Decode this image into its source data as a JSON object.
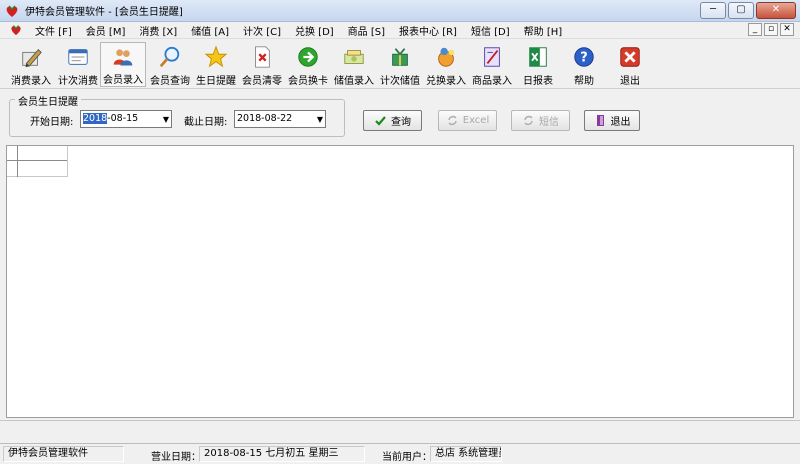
{
  "window": {
    "title": "伊特会员管理软件 - [会员生日提醒]",
    "controls": [
      "─",
      "▢",
      "✕"
    ]
  },
  "menu": {
    "items": [
      "文件 [F]",
      "会员 [M]",
      "消费 [X]",
      "储值 [A]",
      "计次 [C]",
      "兑换 [D]",
      "商品 [S]",
      "报表中心 [R]",
      "短信 [D]",
      "帮助 [H]"
    ],
    "mdi_controls": [
      "_",
      "▫",
      "✕"
    ]
  },
  "toolbar": {
    "buttons": [
      {
        "label": "消费录入",
        "icon": "pen-paper-icon"
      },
      {
        "label": "计次消费",
        "icon": "card-list-icon"
      },
      {
        "label": "会员录入",
        "icon": "members-icon"
      },
      {
        "label": "会员查询",
        "icon": "magnifier-icon"
      },
      {
        "label": "生日提醒",
        "icon": "star-icon"
      },
      {
        "label": "会员清零",
        "icon": "document-x-icon"
      },
      {
        "label": "会员换卡",
        "icon": "green-arrow-icon"
      },
      {
        "label": "储值录入",
        "icon": "money-icon"
      },
      {
        "label": "计次储值",
        "icon": "gift-icon"
      },
      {
        "label": "兑换录入",
        "icon": "exchange-icon"
      },
      {
        "label": "商品录入",
        "icon": "notebook-icon"
      },
      {
        "label": "日报表",
        "icon": "excel-icon"
      },
      {
        "label": "帮助",
        "icon": "help-icon"
      },
      {
        "label": "退出",
        "icon": "exit-x-icon"
      }
    ]
  },
  "filter": {
    "group_title": "会员生日提醒",
    "start_label": "开始日期:",
    "start_value_selected": "2018",
    "start_value_rest": "-08-15",
    "end_label": "截止日期:",
    "end_value": "2018-08-22"
  },
  "actions": {
    "query": "查询",
    "excel": "Excel",
    "sms": "短信",
    "exit": "退出"
  },
  "statusbar": {
    "app_name": "伊特会员管理软件",
    "business_date_label": "营业日期：",
    "business_date_value": "2018-08-15  七月初五  星期三",
    "current_user_label": "当前用户：",
    "current_user_value": "总店 系统管理员"
  },
  "colors": {
    "titlebar": "#c5d6ee",
    "selection": "#3168c4",
    "close_button": "#c7523b"
  }
}
